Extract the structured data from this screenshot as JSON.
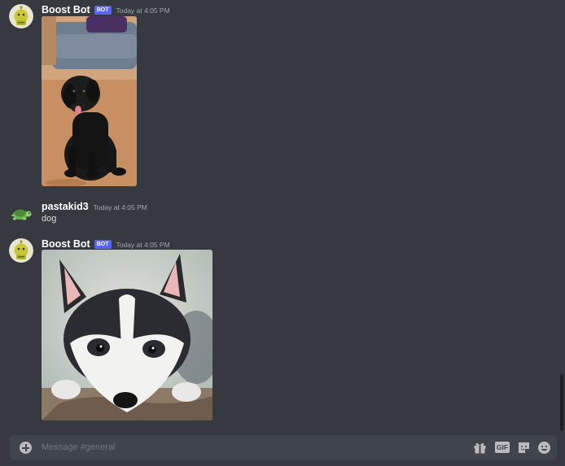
{
  "messages": [
    {
      "username": "Boost Bot",
      "bot_tag": "BOT",
      "timestamp": "Today at 4:05 PM",
      "attachment": "black-labrador-photo"
    },
    {
      "username": "pastakid3",
      "timestamp": "Today at 4:05 PM",
      "text": "dog"
    },
    {
      "username": "Boost Bot",
      "bot_tag": "BOT",
      "timestamp": "Today at 4:05 PM",
      "attachment": "husky-puppy-photo"
    }
  ],
  "composer": {
    "placeholder": "Message #general",
    "icons": [
      "add-icon",
      "gift-icon",
      "gif-icon",
      "sticker-icon",
      "emoji-icon"
    ],
    "gif_label": "GIF"
  },
  "colors": {
    "background": "#36393f",
    "composer": "#40444b",
    "bot_tag": "#5865f2"
  }
}
